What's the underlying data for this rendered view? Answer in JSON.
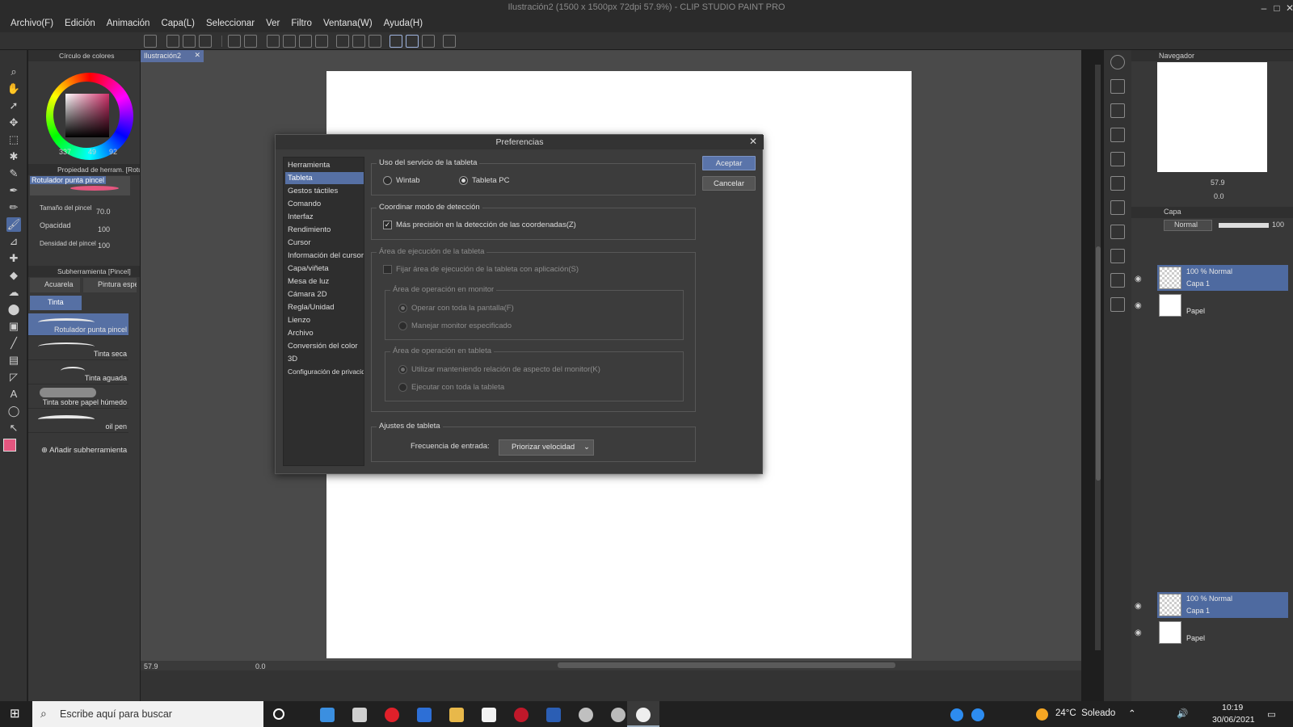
{
  "window": {
    "title": "Ilustración2 (1500 x 1500px 72dpi 57.9%) - CLIP STUDIO PAINT PRO",
    "controls": [
      "minimize",
      "maximize",
      "close"
    ]
  },
  "menu": [
    "Archivo(F)",
    "Edición",
    "Animación",
    "Capa(L)",
    "Seleccionar",
    "Ver",
    "Filtro",
    "Ventana(W)",
    "Ayuda(H)"
  ],
  "color_panel": {
    "title": "Círculo de colores",
    "values": [
      "337",
      "49",
      "92"
    ],
    "main_color": "#e4567f",
    "sub_color": "#ffffff"
  },
  "tool_property": {
    "title": "Propiedad de herram. [Rotulador punta pincel]",
    "brush_name": "Rotulador punta pincel",
    "brush_size_label": "Tamaño del pincel",
    "brush_size_value": "70.0",
    "opacity_label": "Opacidad",
    "opacity_value": "100",
    "density_label": "Densidad del pincel",
    "density_value": "100"
  },
  "subtool_panel": {
    "title": "Subherramienta [Pincel]",
    "groups": [
      "Acuarela",
      "Pintura espesa",
      "Tinta"
    ],
    "brushes": [
      "Rotulador punta pincel",
      "Tinta seca",
      "Tinta aguada",
      "Tinta sobre papel húmedo",
      "oil pen"
    ],
    "add_label": "Añadir subherramienta"
  },
  "document_tab": "Ilustración2",
  "status": {
    "zoom": "57.9",
    "rotation": "0.0"
  },
  "navigator": {
    "title": "Navegador",
    "zoom": "57.9",
    "rotation": "0.0"
  },
  "layer_panel": {
    "title": "Capa",
    "blend_mode": "Normal",
    "opacity": "100",
    "layers": [
      {
        "info": "100 % Normal",
        "name": "Capa 1"
      },
      {
        "info": "",
        "name": "Papel"
      }
    ]
  },
  "dialog": {
    "title": "Preferencias",
    "nav_items": [
      "Herramienta",
      "Tableta",
      "Gestos táctiles",
      "Comando",
      "Interfaz",
      "Rendimiento",
      "Cursor",
      "Información del cursor",
      "Capa/viñeta",
      "Mesa de luz",
      "Cámara 2D",
      "Regla/Unidad",
      "Lienzo",
      "Archivo",
      "Conversión del color",
      "3D",
      "Configuración de privacidad"
    ],
    "selected_nav": "Tableta",
    "ok_label": "Aceptar",
    "cancel_label": "Cancelar",
    "tablet_service": {
      "label": "Uso del servicio de la tableta",
      "options": [
        "Wintab",
        "Tableta PC"
      ],
      "selected": "Tableta PC"
    },
    "detection": {
      "label": "Coordinar modo de detección",
      "checkbox_label": "Más precisión en la detección de las coordenadas(Z)",
      "checked": true
    },
    "area": {
      "label": "Área de ejecución de la tableta",
      "fix_label": "Fijar área de ejecución de la tableta con aplicación(S)",
      "monitor_label": "Área de operación en monitor",
      "monitor_options": [
        "Operar con toda la pantalla(F)",
        "Manejar monitor especificado"
      ],
      "tablet_label": "Área de operación en tableta",
      "tablet_options": [
        "Utilizar manteniendo relación de aspecto del monitor(K)",
        "Ejecutar con toda la tableta"
      ]
    },
    "settings": {
      "label": "Ajustes de tableta",
      "freq_label": "Frecuencia de entrada:",
      "freq_value": "Priorizar velocidad"
    }
  },
  "taskbar": {
    "search_placeholder": "Escribe aquí para buscar",
    "weather": "24°C  Soleado",
    "time": "10:19",
    "date": "30/06/2021"
  }
}
